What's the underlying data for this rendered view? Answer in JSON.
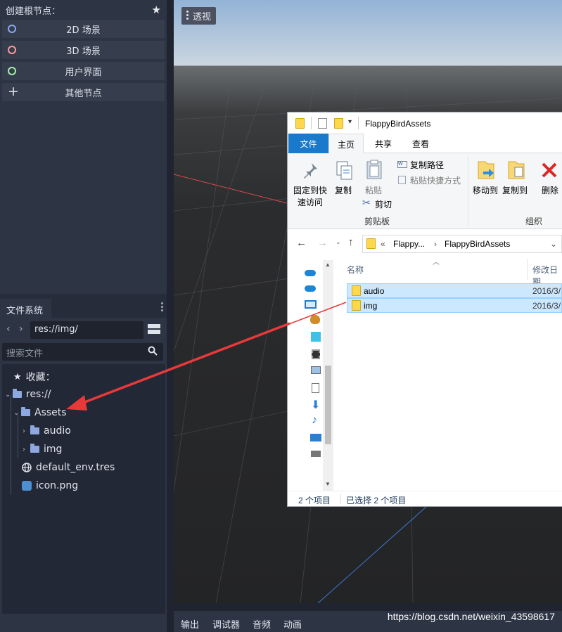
{
  "scene_dock": {
    "title": "创建根节点：",
    "buttons": [
      {
        "label": "2D 场景",
        "color": "#8da5f3"
      },
      {
        "label": "3D 场景",
        "color": "#fc9c9c"
      },
      {
        "label": "用户界面",
        "color": "#a5efac"
      },
      {
        "label": "其他节点"
      }
    ]
  },
  "filesystem": {
    "tab": "文件系统",
    "path": "res://img/",
    "search_placeholder": "搜索文件",
    "tree": {
      "favorites": "收藏：",
      "root": "res://",
      "assets": "Assets",
      "audio": "audio",
      "img": "img",
      "env": "default_env.tres",
      "icon": "icon.png"
    }
  },
  "viewport": {
    "perspective_button": "透视"
  },
  "bottom_bar": {
    "items": [
      "输出",
      "调试器",
      "音频",
      "动画"
    ],
    "watermark": "https://blog.csdn.net/weixin_43598617"
  },
  "explorer": {
    "title": "FlappyBirdAssets",
    "tabs": [
      "文件",
      "主页",
      "共享",
      "查看"
    ],
    "ribbon": {
      "pin": "固定到快速访问",
      "pin_line1": "固定到快",
      "pin_line2": "速访问",
      "copy": "复制",
      "paste": "粘贴",
      "copy_path": "复制路径",
      "paste_shortcut": "粘贴快捷方式",
      "cut": "剪切",
      "clipboard_group": "剪贴板",
      "move_to": "移动到",
      "copy_to": "复制到",
      "delete": "删除",
      "organize_group": "组织"
    },
    "address": {
      "crumb1": "Flappy...",
      "crumb2": "FlappyBirdAssets"
    },
    "columns": {
      "name": "名称",
      "modified": "修改日期"
    },
    "files": [
      {
        "name": "audio",
        "date": "2016/3/"
      },
      {
        "name": "img",
        "date": "2016/3/"
      }
    ],
    "status": {
      "count": "2 个项目",
      "selected": "已选择 2 个项目"
    }
  }
}
